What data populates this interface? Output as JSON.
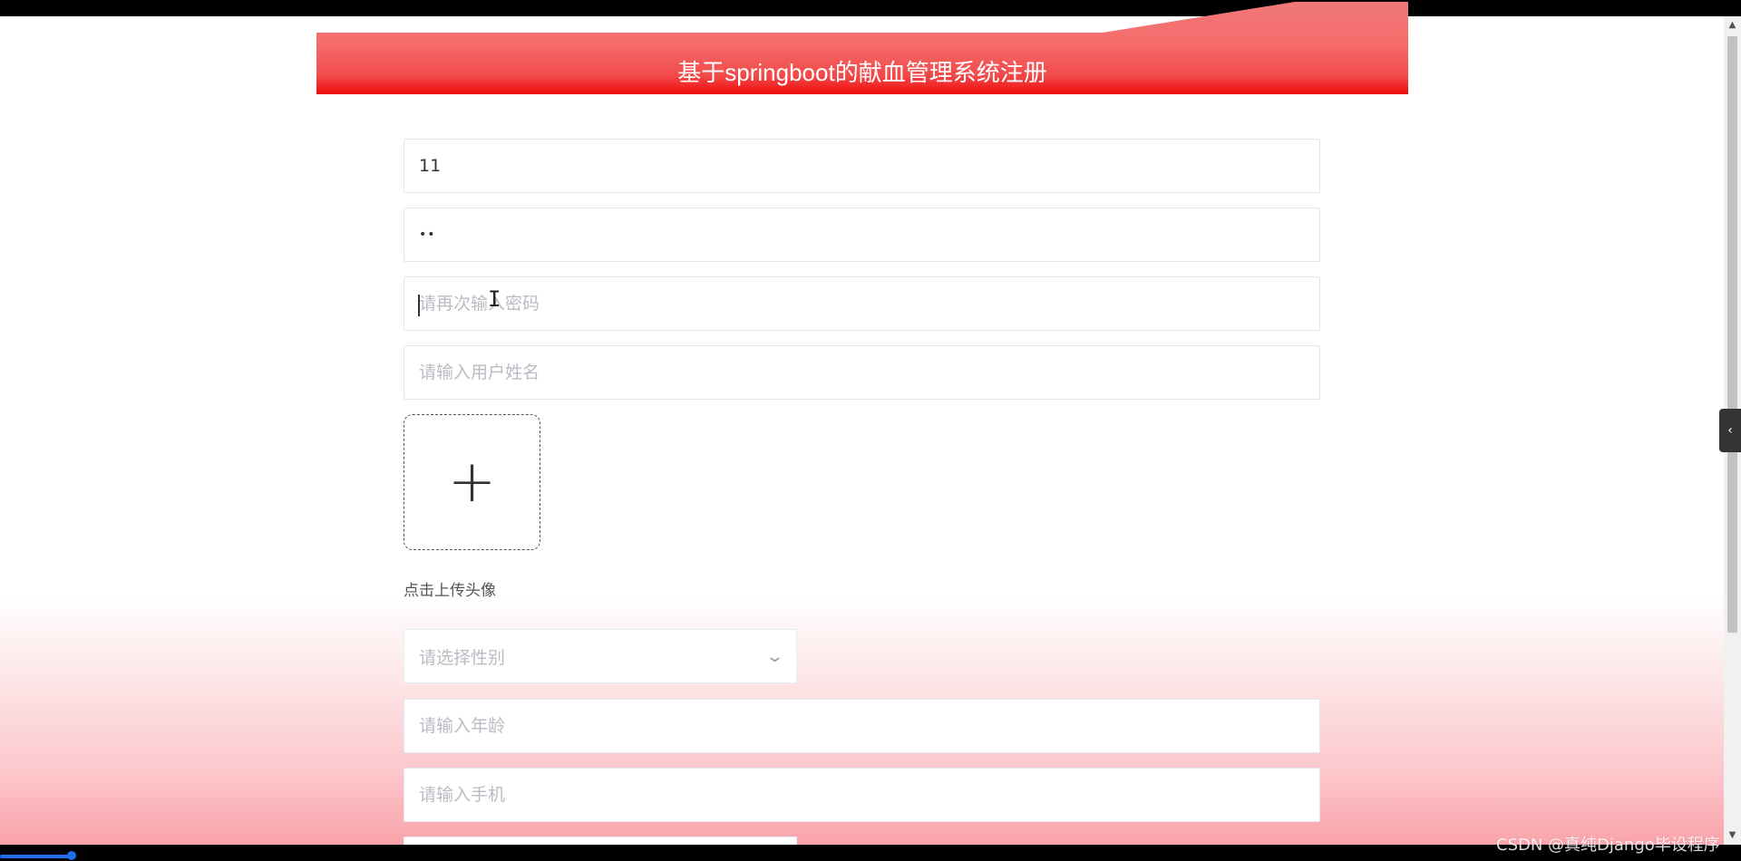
{
  "header": {
    "title": "基于springboot的献血管理系统注册"
  },
  "form": {
    "account_value": "11",
    "password_value": "••",
    "confirm_password_placeholder": "请再次输入密码",
    "name_placeholder": "请输入用户姓名",
    "avatar_upload_label": "点击上传头像",
    "gender_placeholder": "请选择性别",
    "age_placeholder": "请输入年龄",
    "phone_placeholder": "请输入手机"
  },
  "icons": {
    "upload": "plus-icon",
    "select": "chevron-down-icon",
    "side_toggle": "chevron-left-icon"
  },
  "watermark": "CSDN @真纯Django毕设程序",
  "colors": {
    "header_red": "#f56c6c",
    "header_deep_red": "#ee0a0a",
    "placeholder": "#b9bcc3",
    "border": "#e4e7ed"
  }
}
